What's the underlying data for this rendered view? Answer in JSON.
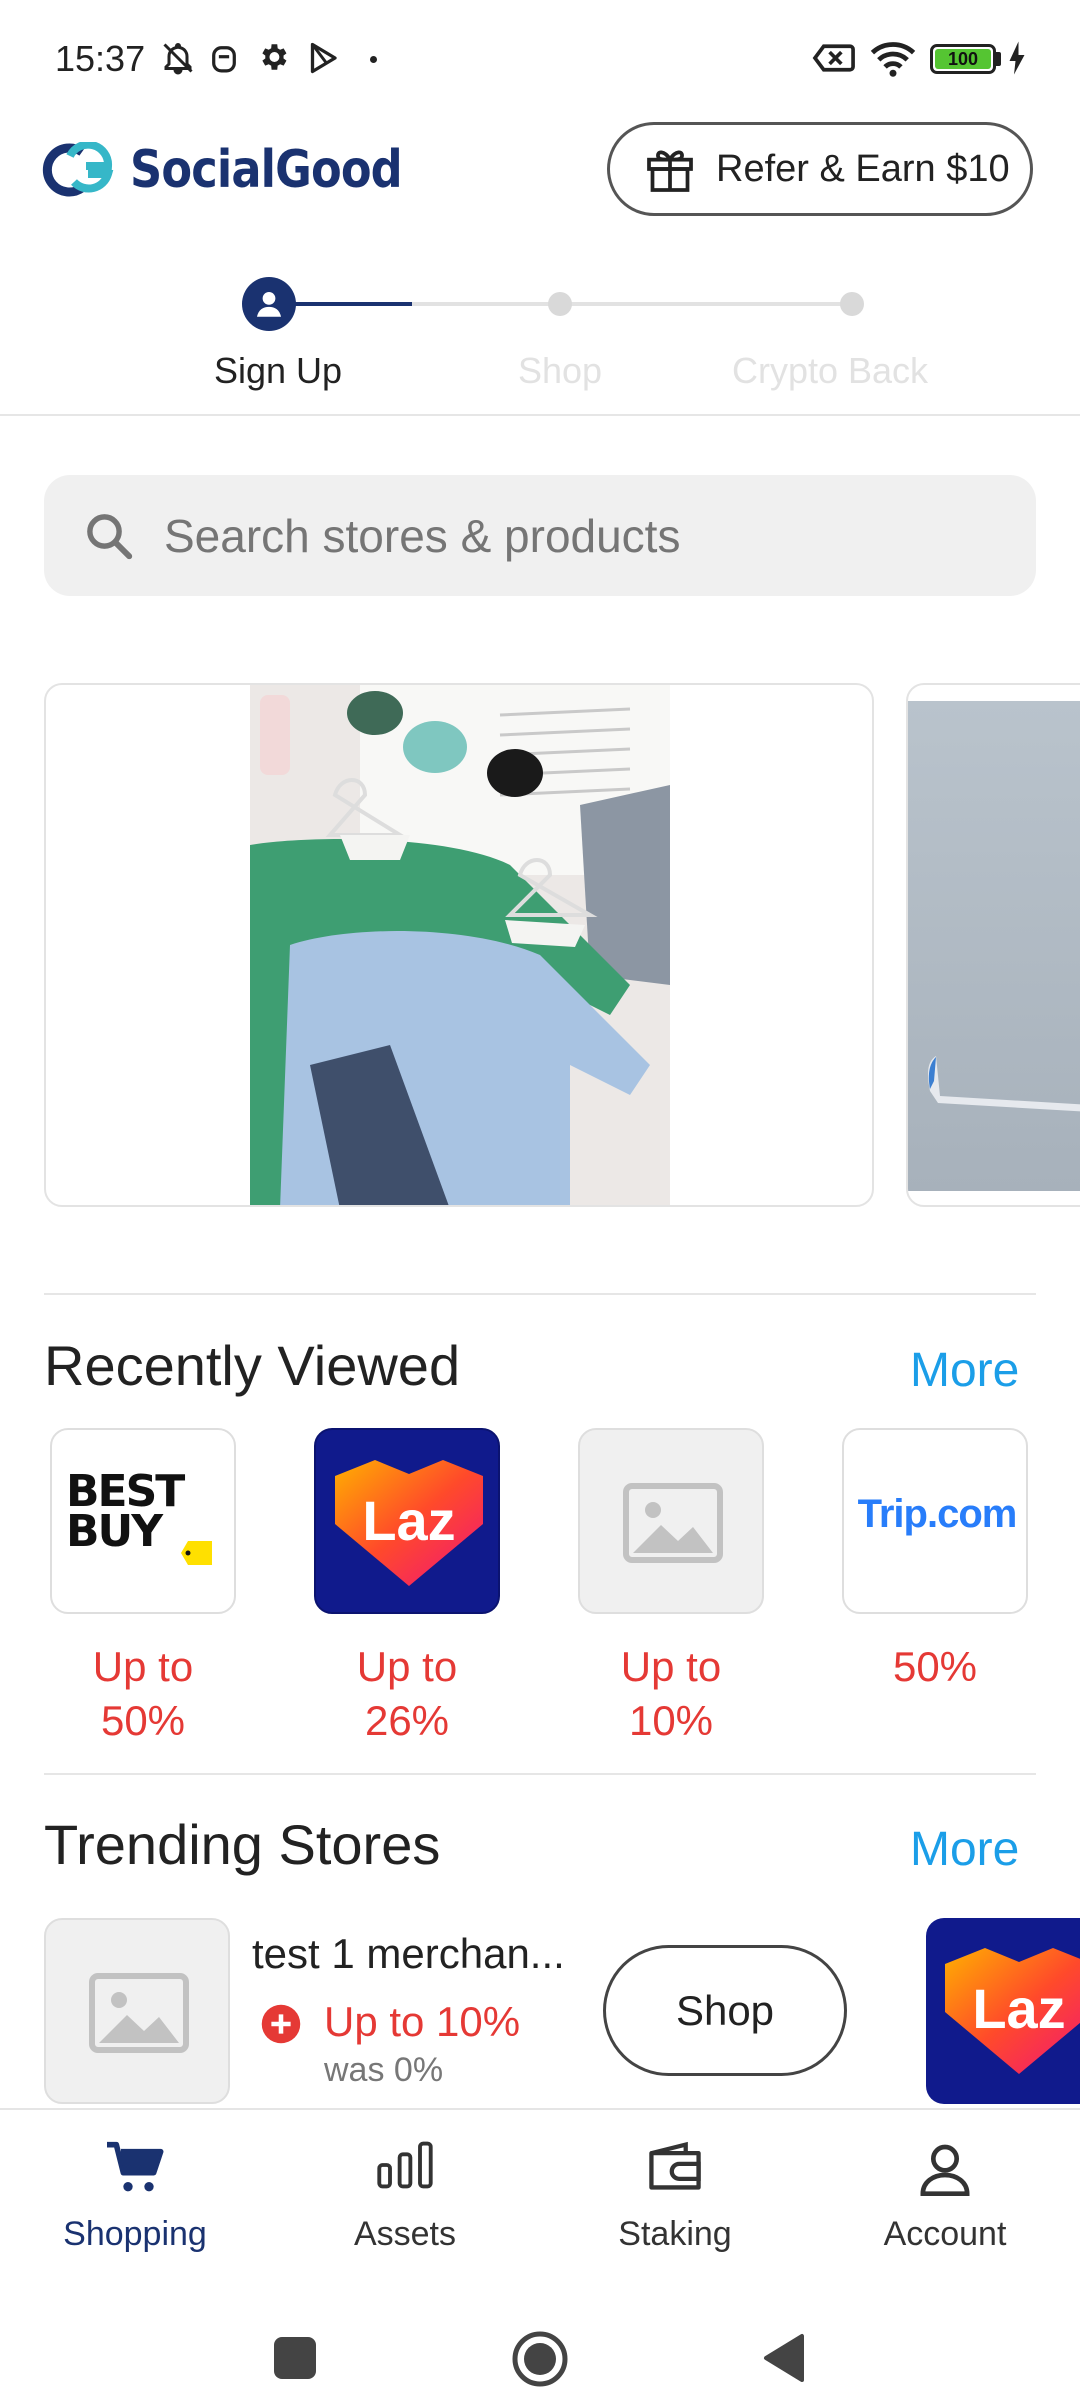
{
  "status_bar": {
    "time": "15:37",
    "battery": "100"
  },
  "header": {
    "brand": "SocialGood",
    "refer_label": "Refer & Earn $10"
  },
  "stepper": {
    "steps": [
      {
        "label": "Sign Up"
      },
      {
        "label": "Shop"
      },
      {
        "label": "Crypto Back"
      }
    ]
  },
  "search": {
    "placeholder": "Search stores & products"
  },
  "recently_viewed": {
    "title": "Recently Viewed",
    "more": "More",
    "items": [
      {
        "name": "BEST BUY",
        "line1": "Up to",
        "line2": "50%"
      },
      {
        "name": "Laz",
        "line1": "Up to",
        "line2": "26%"
      },
      {
        "name": "",
        "line1": "Up to",
        "line2": "10%"
      },
      {
        "name": "Trip.com",
        "line1": "50%",
        "line2": ""
      }
    ]
  },
  "trending": {
    "title": "Trending Stores",
    "more": "More",
    "store": {
      "name": "test 1 merchan...",
      "rate": "Up to 10%",
      "was": "was 0%",
      "shop": "Shop"
    },
    "next_logo": "Laz"
  },
  "bottom_nav": {
    "items": [
      {
        "label": "Shopping",
        "active": true
      },
      {
        "label": "Assets",
        "active": false
      },
      {
        "label": "Staking",
        "active": false
      },
      {
        "label": "Account",
        "active": false
      }
    ]
  },
  "colors": {
    "brand": "#1a3270",
    "accent": "#1b9ee8",
    "discount": "#e53935",
    "active_nav": "#1a3270"
  }
}
